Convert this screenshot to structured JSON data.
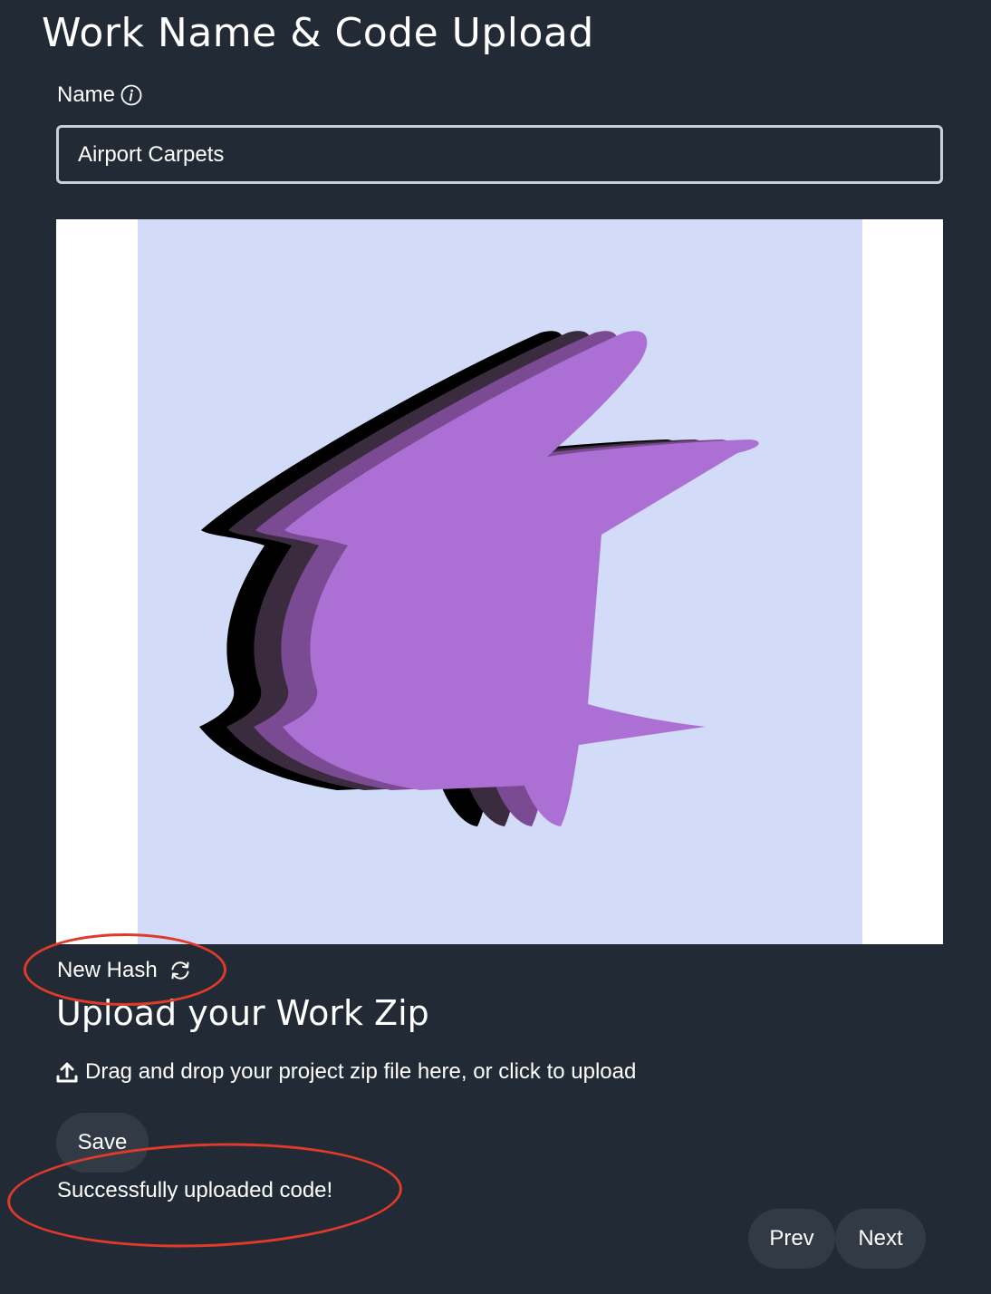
{
  "header": {
    "title": "Work Name & Code Upload"
  },
  "form": {
    "name_label": "Name",
    "name_value": "Airport Carpets"
  },
  "preview": {
    "background_color": "#d2dbf7",
    "shape_colors": [
      "#000000",
      "#3a2b3e",
      "#7a4a93",
      "#ac6fd3"
    ]
  },
  "actions": {
    "new_hash_label": "New Hash"
  },
  "upload": {
    "title": "Upload your Work Zip",
    "dropzone_text": "Drag and drop your project zip file here, or click to upload",
    "save_label": "Save",
    "status_message": "Successfully uploaded code!"
  },
  "navigation": {
    "prev_label": "Prev",
    "next_label": "Next"
  },
  "colors": {
    "page_background": "#222a35",
    "button_background": "#323a46",
    "annotation": "#e03a2a"
  }
}
